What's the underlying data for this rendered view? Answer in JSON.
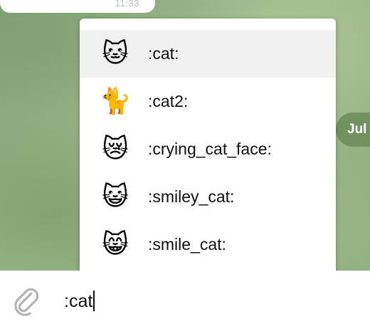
{
  "previous_message": {
    "time": "11:33"
  },
  "date_pill": {
    "label": "Jul"
  },
  "emoji_suggestions": [
    {
      "emoji": "🐱",
      "code": ":cat:",
      "icon": "cat-face-icon",
      "selected": true
    },
    {
      "emoji": "🐈",
      "code": ":cat2:",
      "icon": "cat-icon",
      "selected": false
    },
    {
      "emoji": "😿",
      "code": ":crying_cat_face:",
      "icon": "crying-cat-face-icon",
      "selected": false
    },
    {
      "emoji": "😺",
      "code": ":smiley_cat:",
      "icon": "smiley-cat-icon",
      "selected": false
    },
    {
      "emoji": "😸",
      "code": ":smile_cat:",
      "icon": "smile-cat-icon",
      "selected": false
    }
  ],
  "composer": {
    "text": ":cat",
    "attach_icon": "paperclip-icon"
  },
  "colors": {
    "selected_row": "#f1f1f1",
    "date_pill": "#688c58",
    "attach_icon": "#b4b4b4"
  }
}
